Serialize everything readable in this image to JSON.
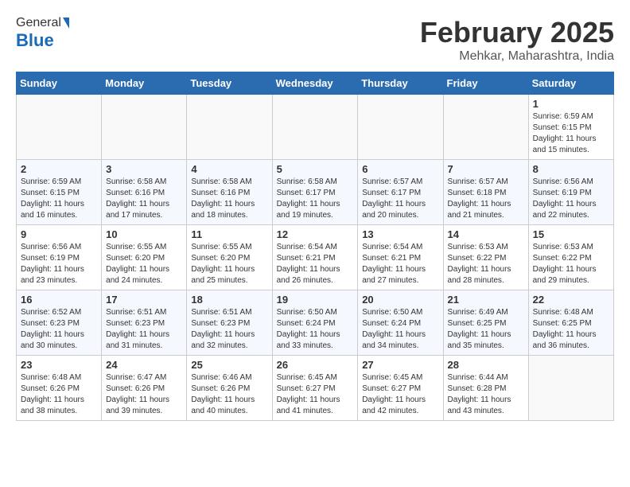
{
  "header": {
    "logo_general": "General",
    "logo_blue": "Blue",
    "month_title": "February 2025",
    "location": "Mehkar, Maharashtra, India"
  },
  "weekdays": [
    "Sunday",
    "Monday",
    "Tuesday",
    "Wednesday",
    "Thursday",
    "Friday",
    "Saturday"
  ],
  "weeks": [
    [
      {
        "day": "",
        "info": ""
      },
      {
        "day": "",
        "info": ""
      },
      {
        "day": "",
        "info": ""
      },
      {
        "day": "",
        "info": ""
      },
      {
        "day": "",
        "info": ""
      },
      {
        "day": "",
        "info": ""
      },
      {
        "day": "1",
        "info": "Sunrise: 6:59 AM\nSunset: 6:15 PM\nDaylight: 11 hours\nand 15 minutes."
      }
    ],
    [
      {
        "day": "2",
        "info": "Sunrise: 6:59 AM\nSunset: 6:15 PM\nDaylight: 11 hours\nand 16 minutes."
      },
      {
        "day": "3",
        "info": "Sunrise: 6:58 AM\nSunset: 6:16 PM\nDaylight: 11 hours\nand 17 minutes."
      },
      {
        "day": "4",
        "info": "Sunrise: 6:58 AM\nSunset: 6:16 PM\nDaylight: 11 hours\nand 18 minutes."
      },
      {
        "day": "5",
        "info": "Sunrise: 6:58 AM\nSunset: 6:17 PM\nDaylight: 11 hours\nand 19 minutes."
      },
      {
        "day": "6",
        "info": "Sunrise: 6:57 AM\nSunset: 6:17 PM\nDaylight: 11 hours\nand 20 minutes."
      },
      {
        "day": "7",
        "info": "Sunrise: 6:57 AM\nSunset: 6:18 PM\nDaylight: 11 hours\nand 21 minutes."
      },
      {
        "day": "8",
        "info": "Sunrise: 6:56 AM\nSunset: 6:19 PM\nDaylight: 11 hours\nand 22 minutes."
      }
    ],
    [
      {
        "day": "9",
        "info": "Sunrise: 6:56 AM\nSunset: 6:19 PM\nDaylight: 11 hours\nand 23 minutes."
      },
      {
        "day": "10",
        "info": "Sunrise: 6:55 AM\nSunset: 6:20 PM\nDaylight: 11 hours\nand 24 minutes."
      },
      {
        "day": "11",
        "info": "Sunrise: 6:55 AM\nSunset: 6:20 PM\nDaylight: 11 hours\nand 25 minutes."
      },
      {
        "day": "12",
        "info": "Sunrise: 6:54 AM\nSunset: 6:21 PM\nDaylight: 11 hours\nand 26 minutes."
      },
      {
        "day": "13",
        "info": "Sunrise: 6:54 AM\nSunset: 6:21 PM\nDaylight: 11 hours\nand 27 minutes."
      },
      {
        "day": "14",
        "info": "Sunrise: 6:53 AM\nSunset: 6:22 PM\nDaylight: 11 hours\nand 28 minutes."
      },
      {
        "day": "15",
        "info": "Sunrise: 6:53 AM\nSunset: 6:22 PM\nDaylight: 11 hours\nand 29 minutes."
      }
    ],
    [
      {
        "day": "16",
        "info": "Sunrise: 6:52 AM\nSunset: 6:23 PM\nDaylight: 11 hours\nand 30 minutes."
      },
      {
        "day": "17",
        "info": "Sunrise: 6:51 AM\nSunset: 6:23 PM\nDaylight: 11 hours\nand 31 minutes."
      },
      {
        "day": "18",
        "info": "Sunrise: 6:51 AM\nSunset: 6:23 PM\nDaylight: 11 hours\nand 32 minutes."
      },
      {
        "day": "19",
        "info": "Sunrise: 6:50 AM\nSunset: 6:24 PM\nDaylight: 11 hours\nand 33 minutes."
      },
      {
        "day": "20",
        "info": "Sunrise: 6:50 AM\nSunset: 6:24 PM\nDaylight: 11 hours\nand 34 minutes."
      },
      {
        "day": "21",
        "info": "Sunrise: 6:49 AM\nSunset: 6:25 PM\nDaylight: 11 hours\nand 35 minutes."
      },
      {
        "day": "22",
        "info": "Sunrise: 6:48 AM\nSunset: 6:25 PM\nDaylight: 11 hours\nand 36 minutes."
      }
    ],
    [
      {
        "day": "23",
        "info": "Sunrise: 6:48 AM\nSunset: 6:26 PM\nDaylight: 11 hours\nand 38 minutes."
      },
      {
        "day": "24",
        "info": "Sunrise: 6:47 AM\nSunset: 6:26 PM\nDaylight: 11 hours\nand 39 minutes."
      },
      {
        "day": "25",
        "info": "Sunrise: 6:46 AM\nSunset: 6:26 PM\nDaylight: 11 hours\nand 40 minutes."
      },
      {
        "day": "26",
        "info": "Sunrise: 6:45 AM\nSunset: 6:27 PM\nDaylight: 11 hours\nand 41 minutes."
      },
      {
        "day": "27",
        "info": "Sunrise: 6:45 AM\nSunset: 6:27 PM\nDaylight: 11 hours\nand 42 minutes."
      },
      {
        "day": "28",
        "info": "Sunrise: 6:44 AM\nSunset: 6:28 PM\nDaylight: 11 hours\nand 43 minutes."
      },
      {
        "day": "",
        "info": ""
      }
    ]
  ]
}
